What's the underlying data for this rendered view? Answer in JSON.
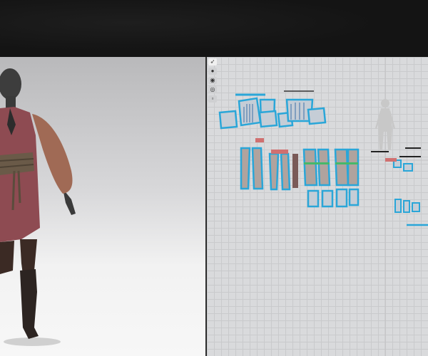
{
  "app": {
    "accent_color": "#2aa6d8",
    "background_color": "#151515"
  },
  "viewport_3d": {
    "avatar_pose": "A-pose",
    "garment_colors": {
      "tunic": "#8e4b52",
      "sleeves": "#a06a55",
      "belt": "#6a5a48",
      "leggings": "#3b2a24",
      "boots": "#2c2421"
    }
  },
  "viewport_2d": {
    "tools": [
      {
        "icon": "select-arrow-icon",
        "glyph": "➶"
      },
      {
        "icon": "transform-icon",
        "glyph": "●"
      },
      {
        "icon": "edit-point-icon",
        "glyph": "◉"
      },
      {
        "icon": "sewing-icon",
        "glyph": "◎"
      },
      {
        "icon": "layer-icon",
        "glyph": "▫"
      }
    ],
    "pattern_outline_color": "#2aa6d8",
    "avatar_silhouette": true
  }
}
